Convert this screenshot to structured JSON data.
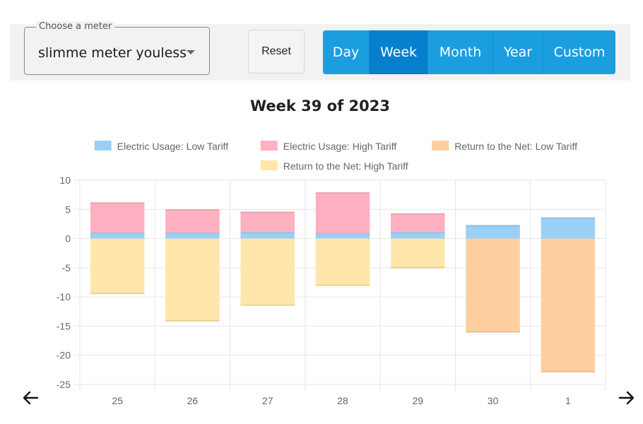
{
  "toolbar": {
    "meter_label": "Choose a meter",
    "meter_value": "slimme meter youless",
    "reset_label": "Reset",
    "periods": [
      "Day",
      "Week",
      "Month",
      "Year",
      "Custom"
    ],
    "active_period": "Week",
    "accent_color": "#1a9ee0",
    "active_color": "#0680cc"
  },
  "navigation": {
    "prev_icon": "arrow-left-icon",
    "next_icon": "arrow-right-icon"
  },
  "chart_data": {
    "type": "bar",
    "stacked": true,
    "title": "Week 39 of 2023",
    "categories": [
      "25",
      "26",
      "27",
      "28",
      "29",
      "30",
      "1"
    ],
    "ylim": [
      -25,
      10
    ],
    "yticks": [
      10,
      5,
      0,
      -5,
      -10,
      -15,
      -20,
      -25
    ],
    "grid": true,
    "legend_position": "top",
    "series": [
      {
        "name": "Electric Usage: Low Tariff",
        "color": "#9ad0f5",
        "values": [
          1.0,
          1.0,
          1.1,
          0.9,
          1.1,
          2.2,
          3.5
        ]
      },
      {
        "name": "Electric Usage: High Tariff",
        "color": "#ffb1c1",
        "values": [
          5.1,
          3.9,
          3.4,
          6.9,
          3.1,
          0,
          0
        ]
      },
      {
        "name": "Return to the Net: Low Tariff",
        "color": "#ffcf9f",
        "values": [
          0,
          0,
          0,
          0,
          0,
          -16.0,
          -22.8
        ]
      },
      {
        "name": "Return to the Net: High Tariff",
        "color": "#ffe6aa",
        "values": [
          -9.4,
          -14.1,
          -11.4,
          -8.0,
          -5.0,
          0,
          0
        ]
      }
    ]
  }
}
